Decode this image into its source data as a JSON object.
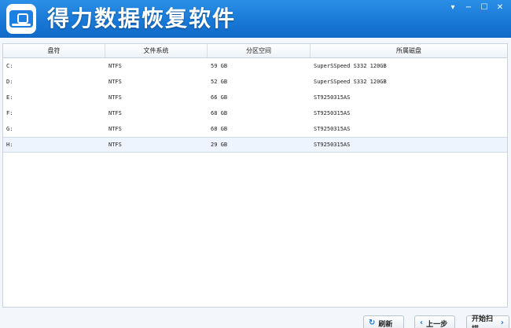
{
  "app": {
    "title": "得力数据恢复软件",
    "window_buttons": {
      "menu": "▾",
      "minimize": "−",
      "maximize": "☐",
      "close": "✕"
    }
  },
  "table": {
    "columns": [
      "盘符",
      "文件系统",
      "分区空间",
      "所属磁盘"
    ],
    "rows": [
      {
        "drive": "C:",
        "fs": "NTFS",
        "size": "59 GB",
        "disk": "SuperSSpeed S332 120GB"
      },
      {
        "drive": "D:",
        "fs": "NTFS",
        "size": "52 GB",
        "disk": "SuperSSpeed S332 120GB"
      },
      {
        "drive": "E:",
        "fs": "NTFS",
        "size": "66 GB",
        "disk": "ST9250315AS"
      },
      {
        "drive": "F:",
        "fs": "NTFS",
        "size": "68 GB",
        "disk": "ST9250315AS"
      },
      {
        "drive": "G:",
        "fs": "NTFS",
        "size": "68 GB",
        "disk": "ST9250315AS"
      },
      {
        "drive": "H:",
        "fs": "NTFS",
        "size": "29 GB",
        "disk": "ST9250315AS"
      }
    ],
    "selected_row": 5
  },
  "buttons": {
    "refresh": "刷新",
    "prev": "上一步",
    "start": "开始扫描"
  },
  "colors": {
    "titlebar": "#1877d6",
    "accent": "#1a78d6"
  }
}
